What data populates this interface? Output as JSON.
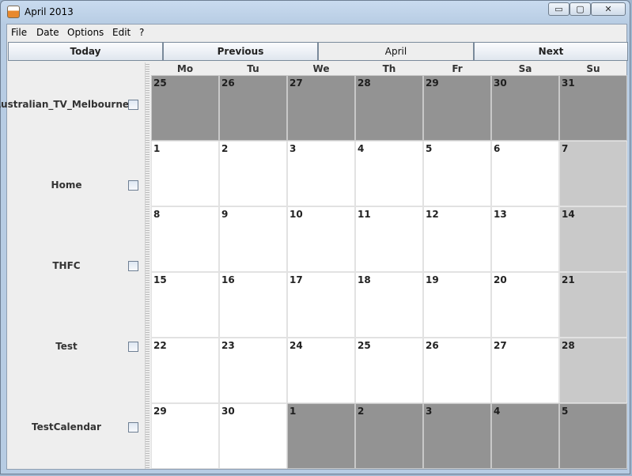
{
  "window": {
    "title": "April 2013",
    "controls": {
      "minimize": "▭",
      "maximize": "▢",
      "close": "✕"
    }
  },
  "menu": [
    "File",
    "Date",
    "Options",
    "Edit",
    "?"
  ],
  "nav": {
    "today": "Today",
    "previous": "Previous",
    "current": "April",
    "next": "Next"
  },
  "calendars": [
    {
      "label": "Australian_TV_Melbourne",
      "checked": false
    },
    {
      "label": "Home",
      "checked": false
    },
    {
      "label": "THFC",
      "checked": false
    },
    {
      "label": "Test",
      "checked": false
    },
    {
      "label": "TestCalendar",
      "checked": false
    }
  ],
  "weekdays": [
    "Mo",
    "Tu",
    "We",
    "Th",
    "Fr",
    "Sa",
    "Su"
  ],
  "weeks": [
    [
      {
        "d": "25",
        "t": "other"
      },
      {
        "d": "26",
        "t": "other"
      },
      {
        "d": "27",
        "t": "other"
      },
      {
        "d": "28",
        "t": "other"
      },
      {
        "d": "29",
        "t": "other"
      },
      {
        "d": "30",
        "t": "other"
      },
      {
        "d": "31",
        "t": "other"
      }
    ],
    [
      {
        "d": "1",
        "t": "cur"
      },
      {
        "d": "2",
        "t": "cur"
      },
      {
        "d": "3",
        "t": "cur"
      },
      {
        "d": "4",
        "t": "cur"
      },
      {
        "d": "5",
        "t": "cur"
      },
      {
        "d": "6",
        "t": "cur"
      },
      {
        "d": "7",
        "t": "sun"
      }
    ],
    [
      {
        "d": "8",
        "t": "cur"
      },
      {
        "d": "9",
        "t": "cur"
      },
      {
        "d": "10",
        "t": "cur"
      },
      {
        "d": "11",
        "t": "cur"
      },
      {
        "d": "12",
        "t": "cur"
      },
      {
        "d": "13",
        "t": "cur"
      },
      {
        "d": "14",
        "t": "sun"
      }
    ],
    [
      {
        "d": "15",
        "t": "cur"
      },
      {
        "d": "16",
        "t": "cur"
      },
      {
        "d": "17",
        "t": "cur"
      },
      {
        "d": "18",
        "t": "cur"
      },
      {
        "d": "19",
        "t": "cur"
      },
      {
        "d": "20",
        "t": "cur"
      },
      {
        "d": "21",
        "t": "sun"
      }
    ],
    [
      {
        "d": "22",
        "t": "cur"
      },
      {
        "d": "23",
        "t": "cur"
      },
      {
        "d": "24",
        "t": "cur"
      },
      {
        "d": "25",
        "t": "cur"
      },
      {
        "d": "26",
        "t": "cur"
      },
      {
        "d": "27",
        "t": "cur"
      },
      {
        "d": "28",
        "t": "sun"
      }
    ],
    [
      {
        "d": "29",
        "t": "cur"
      },
      {
        "d": "30",
        "t": "cur"
      },
      {
        "d": "1",
        "t": "other"
      },
      {
        "d": "2",
        "t": "other"
      },
      {
        "d": "3",
        "t": "other"
      },
      {
        "d": "4",
        "t": "other"
      },
      {
        "d": "5",
        "t": "other"
      }
    ]
  ]
}
